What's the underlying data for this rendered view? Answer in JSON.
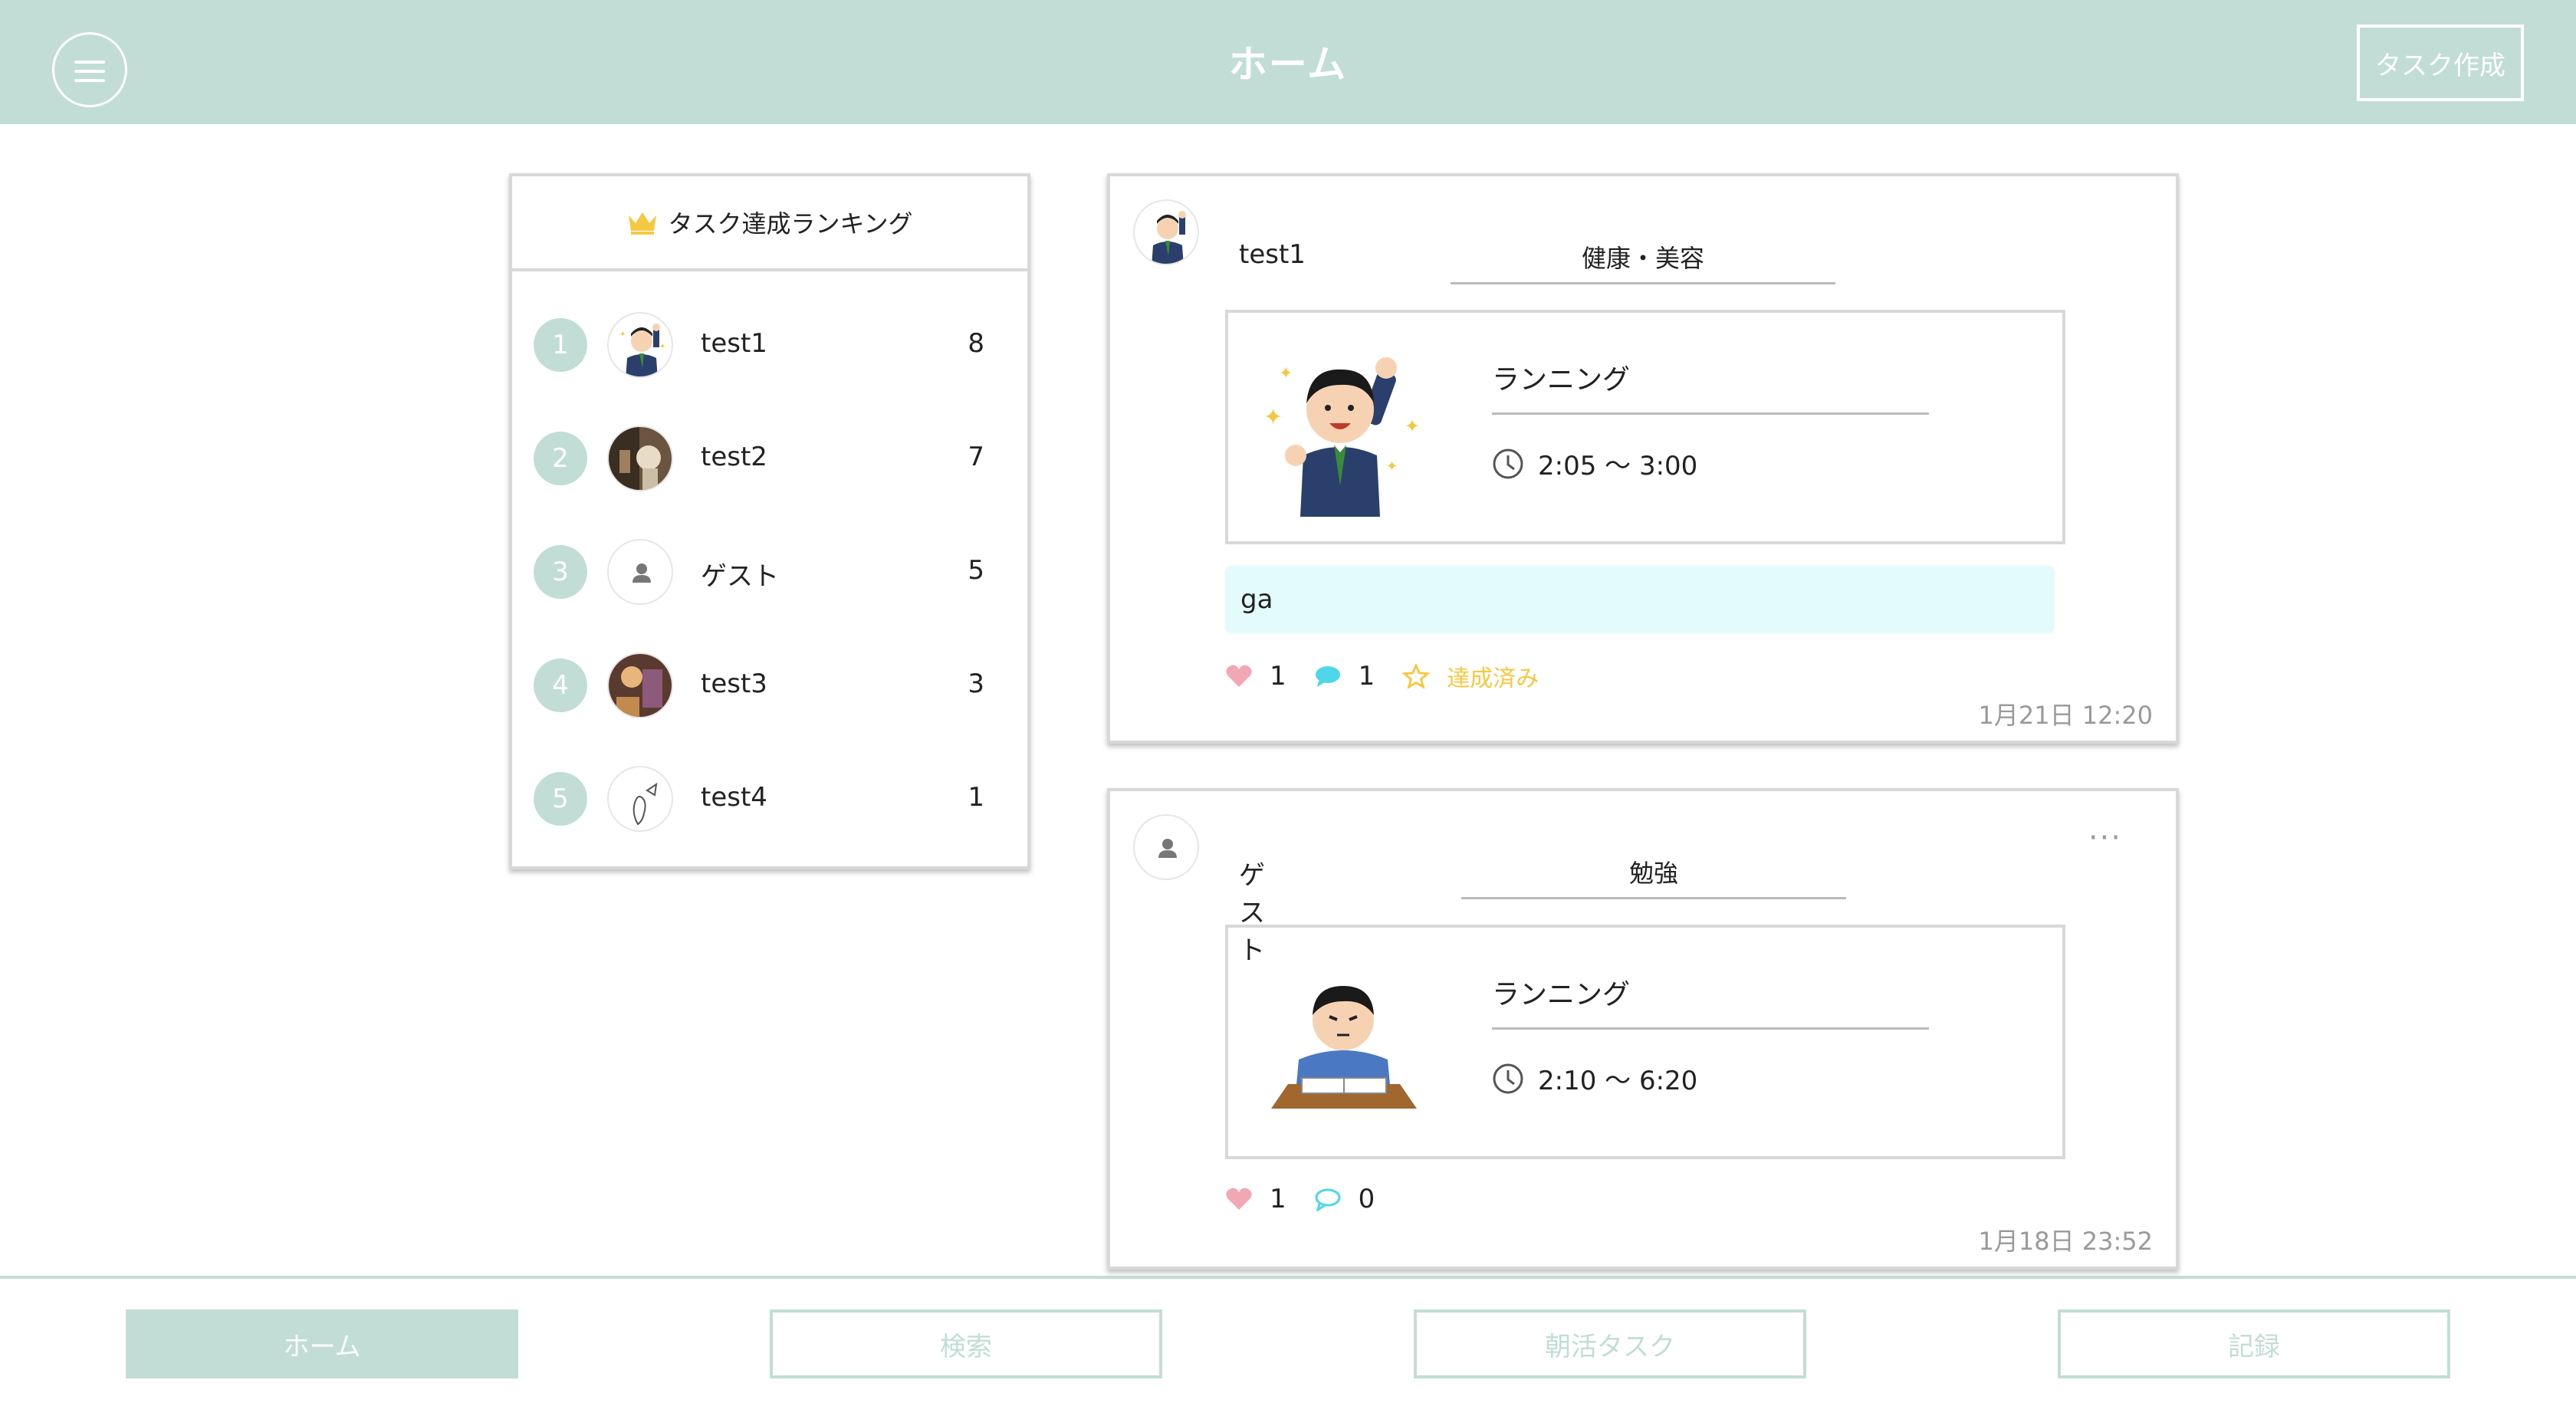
{
  "header": {
    "title": "ホーム",
    "create_task_label": "タスク作成"
  },
  "ranking": {
    "title": "タスク達成ランキング",
    "items": [
      {
        "rank": "1",
        "name": "test1",
        "score": "8"
      },
      {
        "rank": "2",
        "name": "test2",
        "score": "7"
      },
      {
        "rank": "3",
        "name": "ゲスト",
        "score": "5"
      },
      {
        "rank": "4",
        "name": "test3",
        "score": "3"
      },
      {
        "rank": "5",
        "name": "test4",
        "score": "1"
      }
    ]
  },
  "posts": [
    {
      "username": "test1",
      "category": "健康・美容",
      "task_name": "ランニング",
      "task_time": "2:05 〜 3:00",
      "comment": "ga",
      "likes": "1",
      "comments": "1",
      "status": "達成済み",
      "timestamp": "1月21日 12:20"
    },
    {
      "username": "ゲスト",
      "category": "勉強",
      "task_name": "ランニング",
      "task_time": "2:10 〜 6:20",
      "likes": "1",
      "comments": "0",
      "timestamp": "1月18日 23:52"
    }
  ],
  "bottom_nav": {
    "items": [
      {
        "label": "ホーム",
        "active": true
      },
      {
        "label": "検索"
      },
      {
        "label": "朝活タスク"
      },
      {
        "label": "記録"
      }
    ]
  },
  "colors": {
    "accent": "#c1ddd6",
    "heart": "#f2a7b5",
    "comment_icon": "#4fd6e8",
    "achieved": "#f5c842",
    "comment_bg": "#e4fbfb"
  }
}
